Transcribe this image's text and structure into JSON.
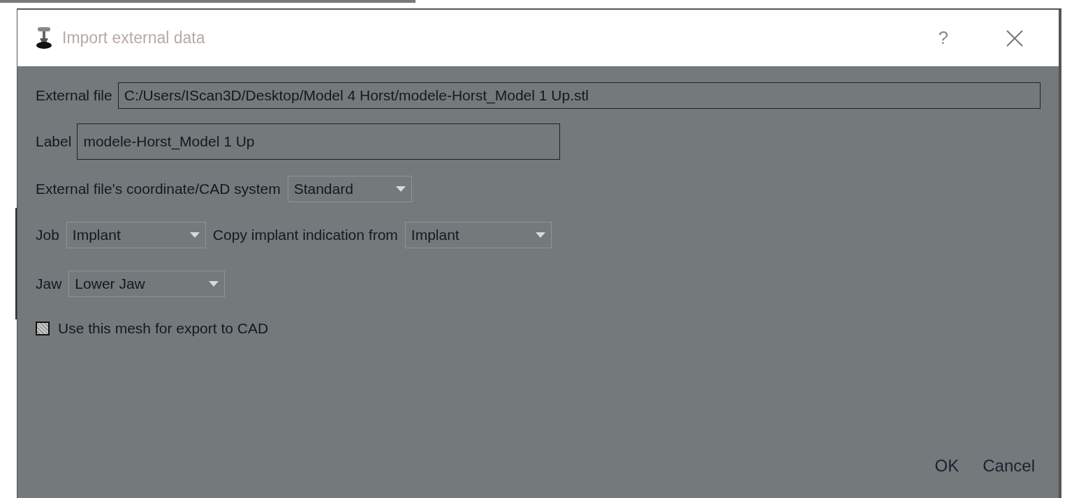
{
  "window": {
    "title": "Import external data",
    "help": "?"
  },
  "external_file": {
    "label": "External file",
    "value": "C:/Users/IScan3D/Desktop/Model 4 Horst/modele-Horst_Model 1 Up.stl"
  },
  "label_field": {
    "label": "Label",
    "value": "modele-Horst_Model 1 Up"
  },
  "coordinate_system": {
    "label": "External file's coordinate/CAD system",
    "value": "Standard"
  },
  "job": {
    "label": "Job",
    "value": "Implant"
  },
  "copy_indication": {
    "label": "Copy implant indication from",
    "value": "Implant"
  },
  "jaw": {
    "label": "Jaw",
    "value": "Lower Jaw"
  },
  "export_checkbox": {
    "label": "Use this mesh for export to CAD",
    "indeterminate": true
  },
  "buttons": [
    "OK",
    "Cancel"
  ]
}
